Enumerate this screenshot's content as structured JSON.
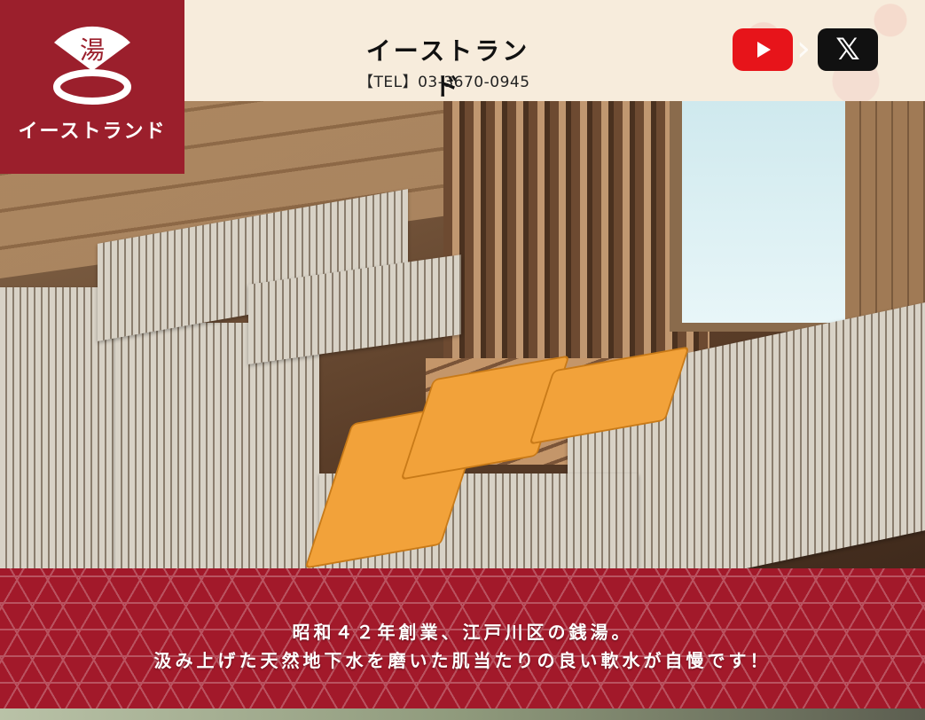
{
  "brand": {
    "logo_kanji": "湯",
    "logo_text": "イーストランド",
    "title": "イーストランド",
    "tel": "【TEL】03-3670-0945"
  },
  "social": {
    "youtube_icon": "youtube-play-icon",
    "x_icon": "x-logo-icon",
    "x_label": "𝕏"
  },
  "banner": {
    "line1": "昭和４２年創業、江戸川区の銭湯。",
    "line2": "汲み上げた天然地下水を磨いた肌当たりの良い軟水が自慢です！"
  },
  "colors": {
    "brand_red": "#9b1f2c",
    "youtube_red": "#e7141a",
    "header_bg": "#f7ecdc"
  }
}
